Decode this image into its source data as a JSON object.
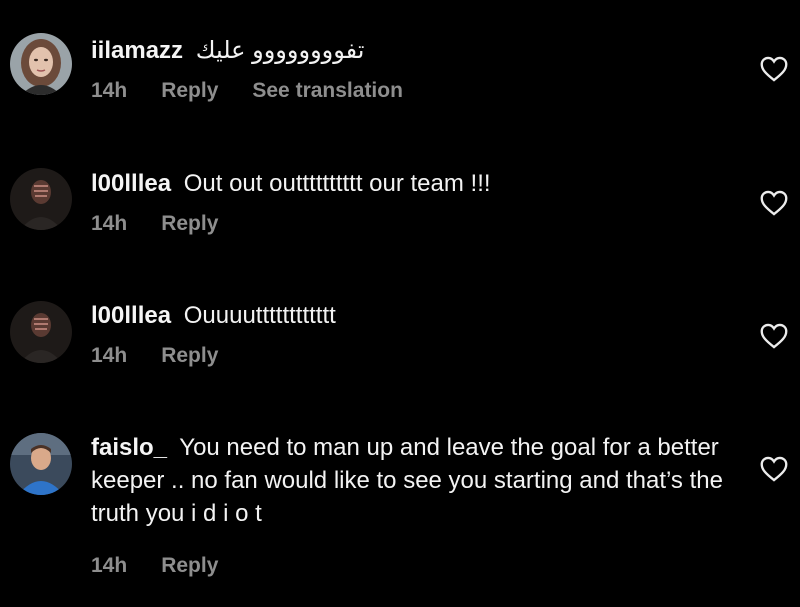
{
  "colors": {
    "background": "#000000",
    "text": "#f3f3f3",
    "meta": "#8e8e8e"
  },
  "comments": [
    {
      "username": "iilamazz",
      "text": "تفوووووووو عليك",
      "time": "14h",
      "reply_label": "Reply",
      "translate_label": "See translation",
      "avatar_icon": "profile-photo-woman",
      "like_icon": "heart-outline-icon"
    },
    {
      "username": "l00lllea",
      "text": "Out out outttttttttt our team !!!",
      "time": "14h",
      "reply_label": "Reply",
      "avatar_icon": "profile-photo-dark",
      "like_icon": "heart-outline-icon"
    },
    {
      "username": "l00lllea",
      "text": "Ouuuutttttttttttt",
      "time": "14h",
      "reply_label": "Reply",
      "avatar_icon": "profile-photo-dark",
      "like_icon": "heart-outline-icon"
    },
    {
      "username": "faislo_",
      "text": "You need to man up and leave the goal for a better keeper .. no fan would like to see you starting and that’s the truth you i d i o t",
      "time": "14h",
      "reply_label": "Reply",
      "avatar_icon": "profile-photo-man",
      "like_icon": "heart-outline-icon"
    }
  ]
}
